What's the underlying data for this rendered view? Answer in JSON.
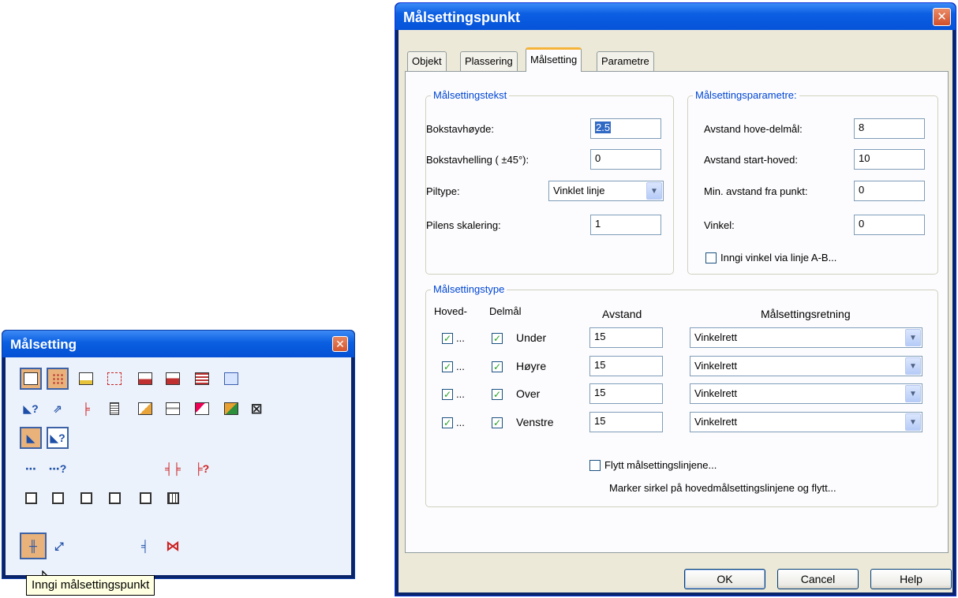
{
  "toolbar": {
    "title": "Målsetting",
    "close_label": "✕",
    "tooltip": "Inngi målsettingspunkt",
    "icons": {
      "row1": [
        "dimension-object-icon",
        "dimension-grid-icon",
        "dimension-edit-icon",
        "dimension-dashed-icon",
        "dimension-red-bar-icon",
        "dimension-red-bar-2-icon",
        "dimension-table-icon",
        "dimension-window-icon"
      ],
      "row2": [
        "dimension-query-icon",
        "dimension-arrow-icon",
        "dimension-bracket-icon",
        "dimension-list-icon",
        "dimension-edit-text-icon",
        "dimension-label-icon",
        "dimension-move-icon",
        "dimension-color-icon",
        "dimension-delete-icon"
      ],
      "row3": [
        "dimension-angle-icon",
        "dimension-query-2-icon"
      ],
      "row4": [
        "dimension-point-icon",
        "dimension-point-query-icon",
        "dimension-split-icon",
        "dimension-split-query-icon"
      ],
      "row5": [
        "dimension-box-1-icon",
        "dimension-box-2-icon",
        "dimension-box-3-icon",
        "dimension-box-4-icon",
        "dimension-box-5-icon",
        "dimension-box-6-icon"
      ],
      "row6": [
        "dimension-point-input-icon",
        "dimension-diagonal-icon",
        "dimension-measure-icon",
        "dimension-cross-icon"
      ]
    }
  },
  "dialog": {
    "title": "Målsettingspunkt",
    "close_label": "✕",
    "tabs": [
      "Objekt",
      "Plassering",
      "Målsetting",
      "Parametre"
    ],
    "active_tab": "Målsetting",
    "text_group": {
      "legend": "Målsettingstekst",
      "fields": [
        {
          "label": "Bokstavhøyde:",
          "value": "2.5"
        },
        {
          "label": "Bokstavhelling ( ±45°):",
          "value": "0"
        },
        {
          "label": "Piltype:",
          "value": "Vinklet linje"
        },
        {
          "label": "Pilens skalering:",
          "value": "1"
        }
      ]
    },
    "param_group": {
      "legend": "Målsettingsparametre:",
      "fields": [
        {
          "label": "Avstand hove-delmål:",
          "value": "8"
        },
        {
          "label": "Avstand start-hoved:",
          "value": "10"
        },
        {
          "label": "Min. avstand fra punkt:",
          "value": "0"
        },
        {
          "label": "Vinkel:",
          "value": "0"
        }
      ],
      "checkbox_label": "Inngi vinkel via linje A-B..."
    },
    "type_group": {
      "legend": "Målsettingstype",
      "headers": {
        "main": "Hoved-",
        "sub": "Delmål",
        "distance": "Avstand",
        "direction": "Målsettingsretning"
      },
      "ellipsis": "...",
      "check_mark": "✓",
      "rows": [
        {
          "side": "Under",
          "distance": "15",
          "direction": "Vinkelrett"
        },
        {
          "side": "Høyre",
          "distance": "15",
          "direction": "Vinkelrett"
        },
        {
          "side": "Over",
          "distance": "15",
          "direction": "Vinkelrett"
        },
        {
          "side": "Venstre",
          "distance": "15",
          "direction": "Vinkelrett"
        }
      ],
      "move_checkbox_label": "Flytt målsettingslinjene...",
      "hint": "Marker sirkel på hovedmålsettingslinjene og flytt..."
    },
    "buttons": {
      "ok": "OK",
      "cancel": "Cancel",
      "help": "Help"
    }
  },
  "colors": {
    "accent": "#0046d5",
    "title_bar": "#0553d8",
    "selected_icon": "#e8b27a",
    "tab_highlight": "#f5b338"
  }
}
